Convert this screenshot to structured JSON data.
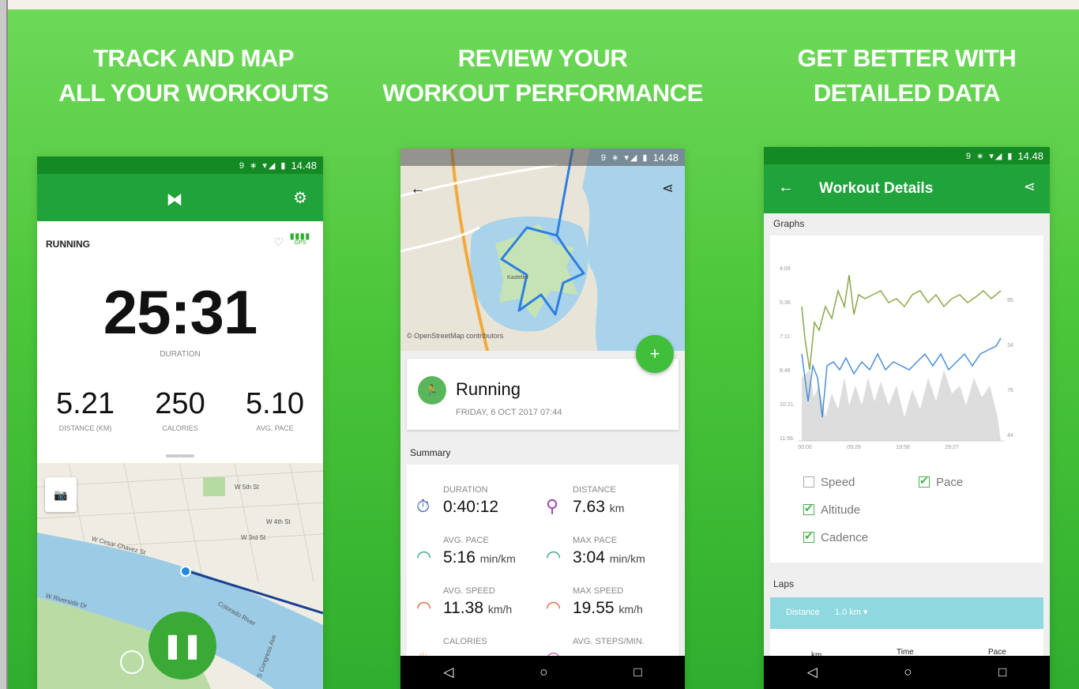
{
  "panels": [
    {
      "headline": [
        "TRACK AND MAP",
        "ALL YOUR WORKOUTS"
      ]
    },
    {
      "headline": [
        "REVIEW YOUR",
        "WORKOUT PERFORMANCE"
      ]
    },
    {
      "headline": [
        "GET BETTER WITH",
        "DETAILED DATA"
      ]
    }
  ],
  "status": {
    "time": "14.48",
    "icons": "9 ∗ ▾◢ ▮"
  },
  "tracker": {
    "logo": "UA",
    "activity": "RUNNING",
    "gps_label": "GPS",
    "duration_value": "25:31",
    "duration_label": "DURATION",
    "stats": [
      {
        "value": "5.21",
        "label": "DISTANCE (KM)"
      },
      {
        "value": "250",
        "label": "CALORIES"
      },
      {
        "value": "5.10",
        "label": "AVG. PACE"
      }
    ],
    "map_labels": [
      "W Cesar Chavez St",
      "W 5th St",
      "W 4th St",
      "W 3rd St",
      "Colorado River",
      "S Congress Ave",
      "W Riverside Dr"
    ]
  },
  "review": {
    "osm_credit": "© OpenStreetMap contributors",
    "map_label": "Kastellet",
    "workout_title": "Running",
    "workout_date": "FRIDAY, 6 OCT 2017 07:44",
    "summary_label": "Summary",
    "metrics": [
      {
        "label": "DURATION",
        "value": "0:40:12",
        "unit": "",
        "icon": "stopwatch-icon",
        "glyph": "⏱",
        "color": "#3b5aa8"
      },
      {
        "label": "DISTANCE",
        "value": "7.63",
        "unit": "km",
        "icon": "distance-pin-icon",
        "glyph": "⚲",
        "color": "#9c3fb5"
      },
      {
        "label": "AVG. PACE",
        "value": "5:16",
        "unit": "min/km",
        "icon": "gauge-icon",
        "glyph": "◠",
        "color": "#2e9e7a"
      },
      {
        "label": "MAX PACE",
        "value": "3:04",
        "unit": "min/km",
        "icon": "gauge-icon",
        "glyph": "◠",
        "color": "#2e9e7a"
      },
      {
        "label": "AVG. SPEED",
        "value": "11.38",
        "unit": "km/h",
        "icon": "speedometer-icon",
        "glyph": "◠",
        "color": "#e4572e"
      },
      {
        "label": "MAX SPEED",
        "value": "19.55",
        "unit": "km/h",
        "icon": "speedometer-icon",
        "glyph": "◠",
        "color": "#e4572e"
      },
      {
        "label": "CALORIES",
        "value": "",
        "unit": "",
        "icon": "flame-icon",
        "glyph": "♨",
        "color": "#f07a1a"
      },
      {
        "label": "AVG. STEPS/MIN.",
        "value": "",
        "unit": "",
        "icon": "steps-icon",
        "glyph": "◠",
        "color": "#c05ab5"
      }
    ]
  },
  "details": {
    "title": "Workout Details",
    "graphs_label": "Graphs",
    "chart": {
      "y_left_ticks": [
        "4:09",
        "5:36",
        "7:11",
        "8:46",
        "10:21",
        "11:56"
      ],
      "y_right_ticks": [
        "95",
        "34",
        "76",
        "44"
      ],
      "x_ticks": [
        "00:00",
        "09:29",
        "19:58",
        "29:27"
      ]
    },
    "toggles": [
      {
        "label": "Speed",
        "checked": false
      },
      {
        "label": "Pace",
        "checked": true
      },
      {
        "label": "Altitude",
        "checked": true
      },
      {
        "label": "Cadence",
        "checked": true
      }
    ],
    "laps_label": "Laps",
    "lap_filter": "Distance",
    "lap_unit": "1.0 km ▾",
    "lap_columns": [
      "km",
      "Time",
      "Pace"
    ]
  },
  "nav": {
    "back": "◁",
    "home": "○",
    "recent": "□"
  },
  "colors": {
    "brand_green": "#1fa33a",
    "pace_line": "#8aa84a",
    "speed_line": "#4a8fd8",
    "cadence_fill": "#dddddd"
  }
}
